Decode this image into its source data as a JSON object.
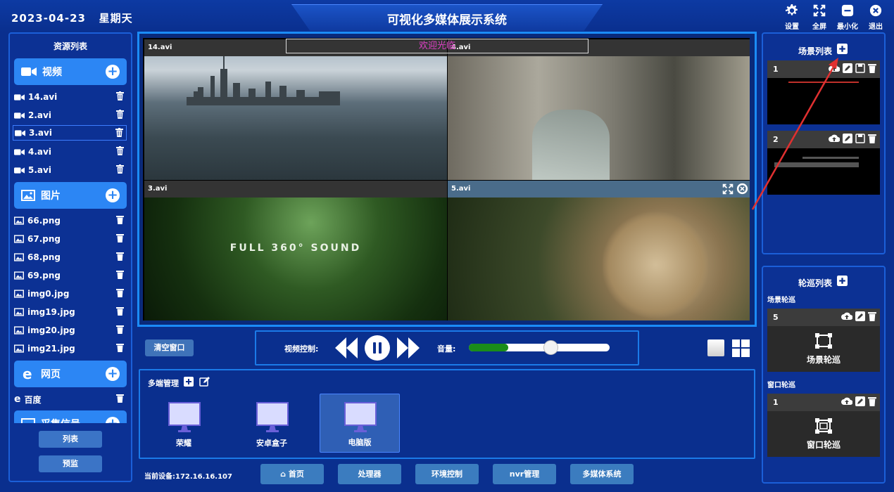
{
  "header": {
    "date": "2023-04-23",
    "weekday": "星期天",
    "title": "可视化多媒体展示系统",
    "buttons": {
      "settings": "设置",
      "fullscreen": "全屏",
      "minimize": "最小化",
      "exit": "退出"
    }
  },
  "resources": {
    "title": "资源列表",
    "video": {
      "label": "视频",
      "items": [
        "14.avi",
        "2.avi",
        "3.avi",
        "4.avi",
        "5.avi"
      ]
    },
    "image": {
      "label": "图片",
      "items": [
        "66.png",
        "67.png",
        "68.png",
        "69.png",
        "img0.jpg",
        "img19.jpg",
        "img20.jpg",
        "img21.jpg"
      ]
    },
    "web": {
      "label": "网页",
      "items": [
        "百度"
      ]
    },
    "capture": {
      "label": "采集信号"
    },
    "list_btn": "列表",
    "preview_btn": "预监"
  },
  "videos": [
    {
      "label": "14.avi"
    },
    {
      "label": "4.avi"
    },
    {
      "label": "3.avi"
    },
    {
      "label": "5.avi"
    }
  ],
  "marquee": "欢迎光临",
  "video3_text": "FULL 360° SOUND",
  "controls": {
    "clear": "清空窗口",
    "video_control": "视频控制:",
    "volume": "音量:",
    "volume_level": 0.23
  },
  "multi": {
    "title": "多端管理",
    "devices": [
      "荣耀",
      "安卓盒子",
      "电脑版"
    ],
    "current": "当前设备:172.16.16.107"
  },
  "nav": [
    "首页",
    "处理器",
    "环境控制",
    "nvr管理",
    "多媒体系统"
  ],
  "scenes": {
    "title": "场景列表",
    "items": [
      "1",
      "2"
    ]
  },
  "tours": {
    "title": "轮巡列表",
    "scene_label": "场景轮巡",
    "scene_item": "5",
    "scene_name": "场景轮巡",
    "window_label": "窗口轮巡",
    "window_item": "1",
    "window_name": "窗口轮巡"
  },
  "colors": {
    "bg": "#0a2f8e",
    "accent": "#2c86f4",
    "panel_border": "#1b5fd8",
    "volume": "#1a8c1a"
  }
}
